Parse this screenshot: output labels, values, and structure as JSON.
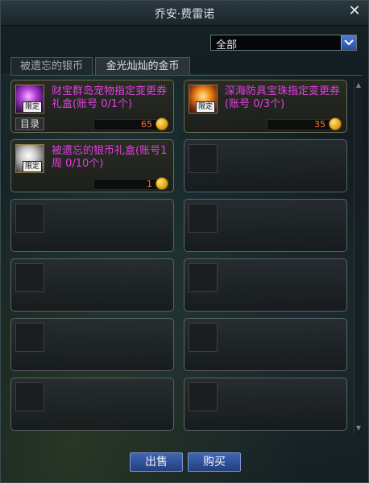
{
  "window": {
    "title": "乔安·费雷诺",
    "close_glyph": "✕"
  },
  "filter": {
    "selected": "全部"
  },
  "tabs": [
    {
      "label": "被遗忘的银币",
      "active": false
    },
    {
      "label": "金光灿灿的金币",
      "active": true
    }
  ],
  "items": [
    {
      "name": "财宝群岛宠物指定变更券礼盒(账号 0/1个)",
      "price": "65",
      "tag": "限定",
      "catalog_label": "目录",
      "icon": "purple-gem-box-icon"
    },
    {
      "name": "深海防具宝珠指定变更券(账号 0/3个)",
      "price": "35",
      "tag": "限定",
      "icon": "orange-orb-icon"
    },
    {
      "name": "被遗忘的银币礼盒(账号1周 0/10个)",
      "price": "1",
      "tag": "限定",
      "icon": "silver-coin-box-icon"
    }
  ],
  "buttons": {
    "sell": "出售",
    "buy": "购买"
  },
  "colors": {
    "item_name": "#e23fe0",
    "price": "#ff6b2e",
    "button": "#2f55a5"
  }
}
